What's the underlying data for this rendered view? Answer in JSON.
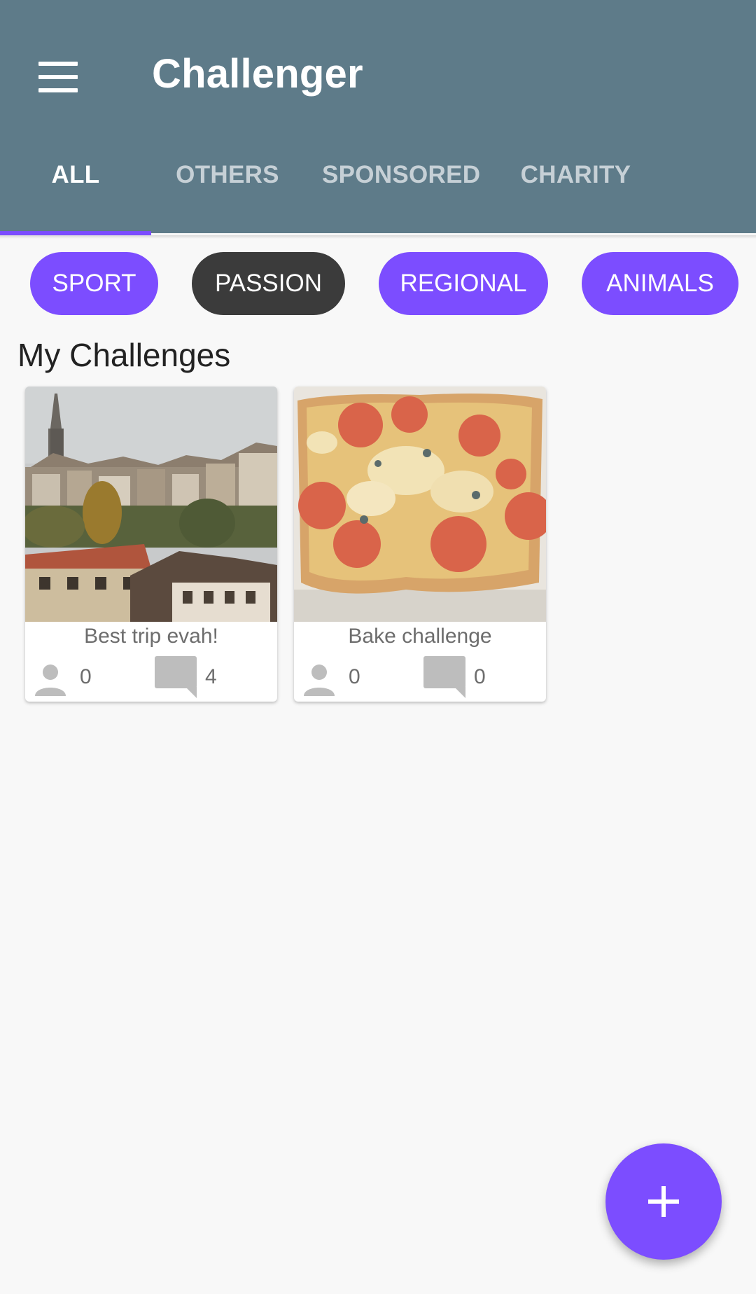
{
  "app_bar": {
    "title": "Challenger",
    "menu_icon": "hamburger-menu-icon",
    "background_color": "#5e7b89"
  },
  "tabs": [
    {
      "label": "ALL",
      "active": true
    },
    {
      "label": "OTHERS",
      "active": false
    },
    {
      "label": "SPONSORED",
      "active": false
    },
    {
      "label": "CHARITY",
      "active": false
    }
  ],
  "accent_color": "#7c4dff",
  "categories": [
    {
      "label": "SPORT",
      "selected": false
    },
    {
      "label": "PASSION",
      "selected": true
    },
    {
      "label": "REGIONAL",
      "selected": false
    },
    {
      "label": "ANIMALS",
      "selected": false
    }
  ],
  "section": {
    "title": "My Challenges"
  },
  "challenges": [
    {
      "title": "Best trip evah!",
      "participants": "0",
      "comments": "4",
      "image": "city-photo"
    },
    {
      "title": "Bake challenge",
      "participants": "0",
      "comments": "0",
      "image": "pizza-photo"
    }
  ],
  "fab": {
    "icon": "plus-icon"
  }
}
